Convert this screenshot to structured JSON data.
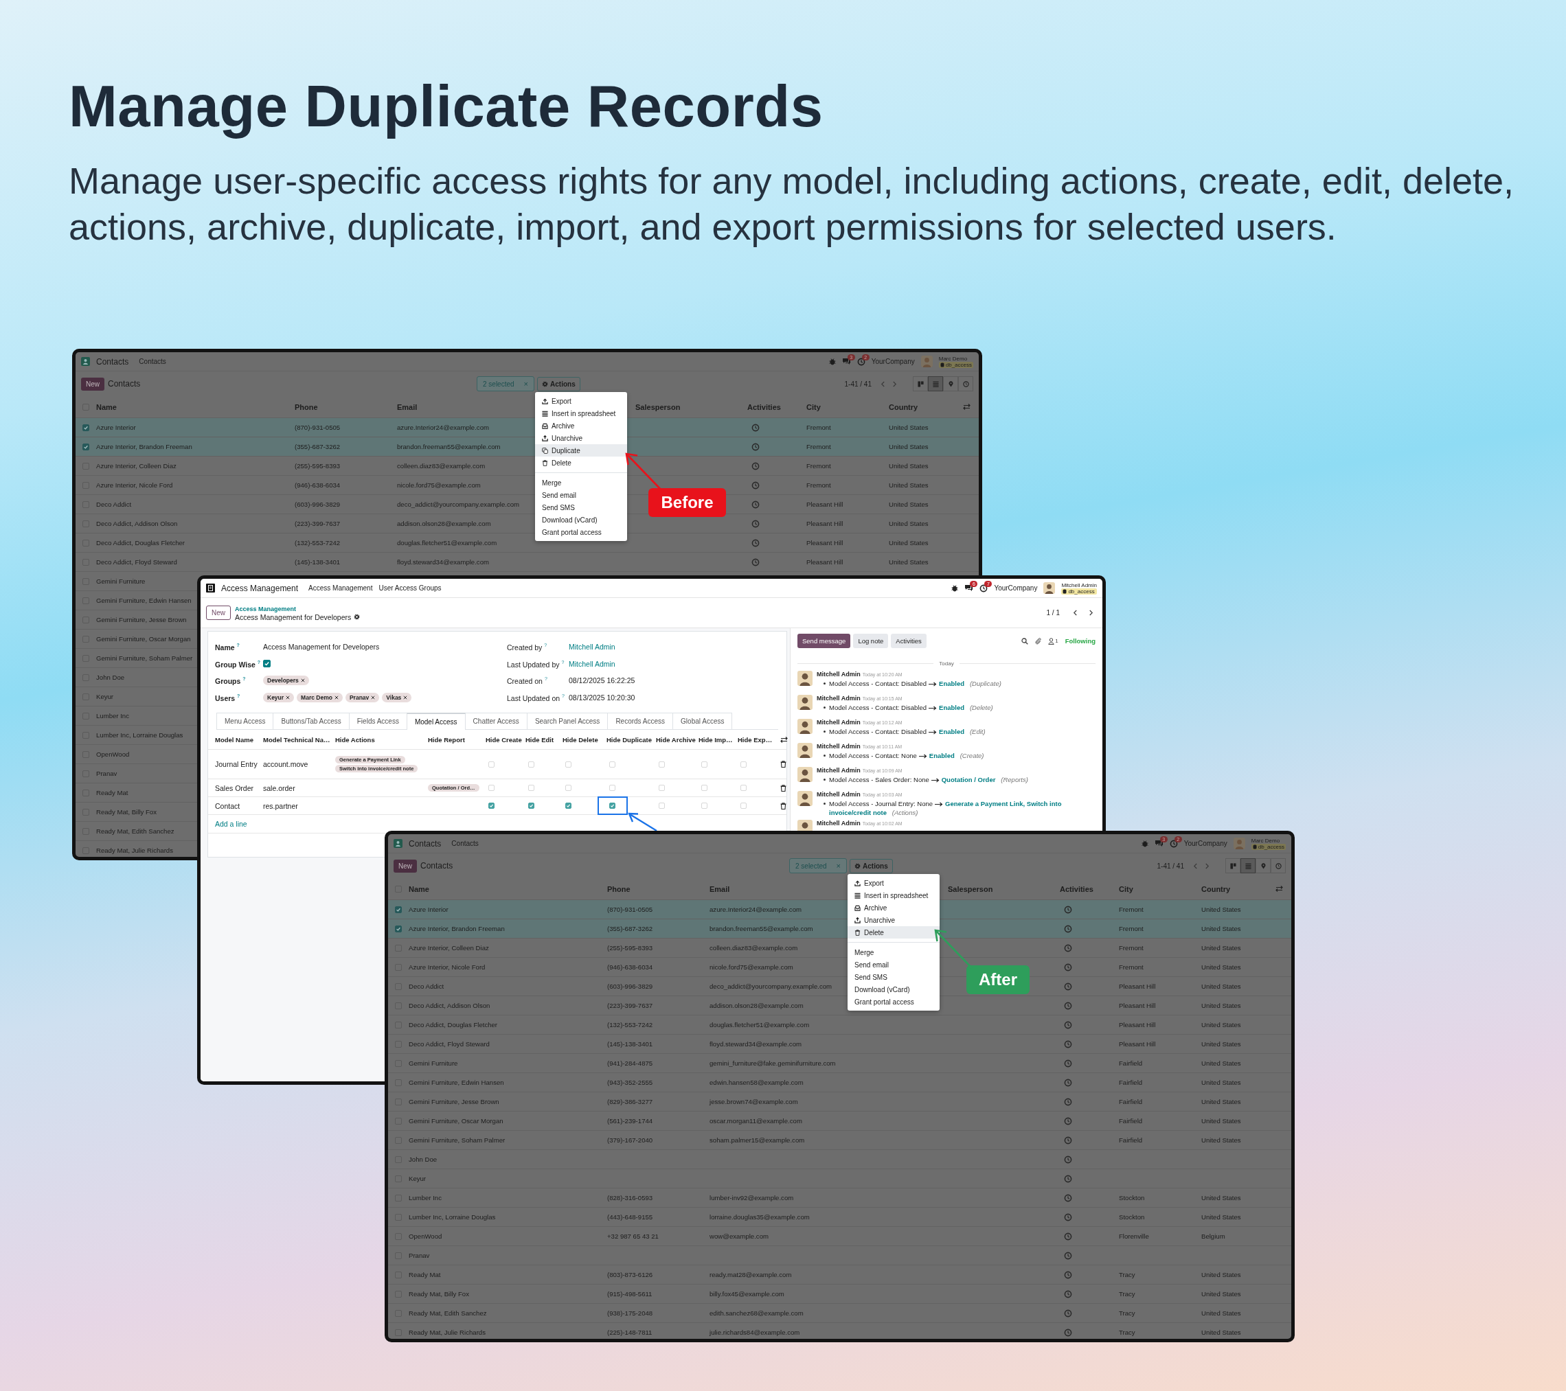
{
  "heading": "Manage Duplicate Records",
  "subheading": "Manage user-specific access rights for any model, including actions, create, edit, delete, actions, archive, duplicate, import, and export permissions for selected users.",
  "before_window": {
    "app_title": "Contacts",
    "menu": [
      "Contacts"
    ],
    "badges": [
      "3",
      "2"
    ],
    "company": "YourCompany",
    "user": "Marc Demo",
    "database": "db_access",
    "new_button": "New",
    "breadcrumb": "Contacts",
    "selection": "2 selected",
    "clear": "×",
    "actions_button": "Actions",
    "pager": "1-41 / 41",
    "views": [
      {
        "kind": "kanban",
        "selected": false
      },
      {
        "kind": "list",
        "selected": true
      },
      {
        "kind": "map",
        "selected": false
      },
      {
        "kind": "activity",
        "selected": false
      }
    ],
    "select_all_checked": false,
    "columns": [
      "Name",
      "Phone",
      "Email",
      "Salesperson",
      "Activities",
      "City",
      "Country"
    ],
    "rows": [
      {
        "name": "Azure Interior",
        "phone": "(870)-931-0505",
        "email": "azure.Interior24@example.com",
        "city": "Fremont",
        "country": "United States",
        "selected": true
      },
      {
        "name": "Azure Interior, Brandon Freeman",
        "phone": "(355)-687-3262",
        "email": "brandon.freeman55@example.com",
        "city": "Fremont",
        "country": "United States",
        "selected": true
      },
      {
        "name": "Azure Interior, Colleen Diaz",
        "phone": "(255)-595-8393",
        "email": "colleen.diaz83@example.com",
        "city": "Fremont",
        "country": "United States",
        "selected": false
      },
      {
        "name": "Azure Interior, Nicole Ford",
        "phone": "(946)-638-6034",
        "email": "nicole.ford75@example.com",
        "city": "Fremont",
        "country": "United States",
        "selected": false
      },
      {
        "name": "Deco Addict",
        "phone": "(603)-996-3829",
        "email": "deco_addict@yourcompany.example.com",
        "city": "Pleasant Hill",
        "country": "United States",
        "selected": false
      },
      {
        "name": "Deco Addict, Addison Olson",
        "phone": "(223)-399-7637",
        "email": "addison.olson28@example.com",
        "city": "Pleasant Hill",
        "country": "United States",
        "selected": false
      },
      {
        "name": "Deco Addict, Douglas Fletcher",
        "phone": "(132)-553-7242",
        "email": "douglas.fletcher51@example.com",
        "city": "Pleasant Hill",
        "country": "United States",
        "selected": false
      },
      {
        "name": "Deco Addict, Floyd Steward",
        "phone": "(145)-138-3401",
        "email": "floyd.steward34@example.com",
        "city": "Pleasant Hill",
        "country": "United States",
        "selected": false
      },
      {
        "name": "Gemini Furniture",
        "selected": false
      },
      {
        "name": "Gemini Furniture, Edwin Hansen",
        "selected": false
      },
      {
        "name": "Gemini Furniture, Jesse Brown",
        "selected": false
      },
      {
        "name": "Gemini Furniture, Oscar Morgan",
        "selected": false
      },
      {
        "name": "Gemini Furniture, Soham Palmer",
        "selected": false
      },
      {
        "name": "John Doe",
        "selected": false
      },
      {
        "name": "Keyur",
        "selected": false
      },
      {
        "name": "Lumber Inc",
        "selected": false
      },
      {
        "name": "Lumber Inc, Lorraine Douglas",
        "selected": false
      },
      {
        "name": "OpenWood",
        "selected": false
      },
      {
        "name": "Pranav",
        "selected": false
      },
      {
        "name": "Ready Mat",
        "selected": false
      },
      {
        "name": "Ready Mat, Billy Fox",
        "selected": false
      },
      {
        "name": "Ready Mat, Edith Sanchez",
        "selected": false
      },
      {
        "name": "Ready Mat, Julie Richards",
        "selected": false
      }
    ],
    "actions_menu": [
      [
        {
          "label": "Export",
          "kind": "export",
          "selected": false
        },
        {
          "label": "Insert in spreadsheet",
          "kind": "spreadsheet",
          "selected": false
        },
        {
          "label": "Archive",
          "kind": "archive",
          "selected": false
        },
        {
          "label": "Unarchive",
          "kind": "unarchive",
          "selected": false
        },
        {
          "label": "Duplicate",
          "kind": "duplicate",
          "selected": true
        },
        {
          "label": "Delete",
          "kind": "delete",
          "selected": false
        }
      ],
      [
        {
          "label": "Merge",
          "kind": "plain",
          "selected": false
        },
        {
          "label": "Send email",
          "kind": "plain",
          "selected": false
        },
        {
          "label": "Send SMS",
          "kind": "plain",
          "selected": false
        },
        {
          "label": "Download (vCard)",
          "kind": "plain",
          "selected": false
        },
        {
          "label": "Grant portal access",
          "kind": "plain",
          "selected": false
        }
      ]
    ],
    "callout": {
      "label": "Before",
      "color": "#e8121b"
    }
  },
  "access_window": {
    "app_title": "Access Management",
    "menu": [
      "Access Management",
      "User Access Groups"
    ],
    "badges": [
      "6",
      "7"
    ],
    "company": "YourCompany",
    "user": "Mitchell Admin",
    "database": "db_access",
    "new_button": "New",
    "breadcrumb_parent": "Access Management",
    "record_title": "Access Management for Developers",
    "pager": "1 / 1",
    "fields_left": [
      {
        "label": "Name $^{?}$",
        "kind": "text",
        "value": "Access Management for Developers"
      },
      {
        "label": "Group Wise $^{?}$",
        "kind": "checkbox",
        "checked": true
      },
      {
        "label": "Groups $^{?}$",
        "kind": "tags",
        "tags": [
          "Developers"
        ]
      },
      {
        "label": "Users $^{?}$",
        "kind": "tags",
        "tags": [
          "Keyur",
          "Marc Demo",
          "Pranav",
          "Vikas"
        ]
      }
    ],
    "fields_right": [
      {
        "label": "Created by $^{?}$",
        "kind": "link",
        "value": "Mitchell Admin"
      },
      {
        "label": "Last Updated by $^{?}$",
        "kind": "link",
        "value": "Mitchell Admin"
      },
      {
        "label": "Created on $^{?}$",
        "kind": "text",
        "value": "08/12/2025 16:22:25"
      },
      {
        "label": "Last Updated on $^{?}$",
        "kind": "text",
        "value": "08/13/2025 10:20:30"
      }
    ],
    "tabs": [
      {
        "label": "Menu Access",
        "selected": false
      },
      {
        "label": "Buttons/Tab Access",
        "selected": false
      },
      {
        "label": "Fields Access",
        "selected": false
      },
      {
        "label": "Model Access",
        "selected": true
      },
      {
        "label": "Chatter Access",
        "selected": false
      },
      {
        "label": "Search Panel Access",
        "selected": false
      },
      {
        "label": "Records Access",
        "selected": false
      },
      {
        "label": "Global Access",
        "selected": false
      }
    ],
    "table": {
      "columns": [
        "Model Name",
        "Model Technical Na…",
        "Hide Actions",
        "Hide Report",
        "Hide Create",
        "Hide Edit",
        "Hide Delete",
        "Hide Duplicate",
        "Hide Archive",
        "Hide Imp…",
        "Hide Exp…"
      ],
      "rows": [
        {
          "model": "Journal Entry",
          "technical": "account.move",
          "actions": [
            "Generate a Payment Link",
            "Switch into invoice/credit note"
          ],
          "reports": [],
          "checks": [
            false,
            false,
            false,
            false,
            false,
            false,
            false
          ]
        },
        {
          "model": "Sales Order",
          "technical": "sale.order",
          "actions": [],
          "reports": [
            "Quotation / Ord…"
          ],
          "checks": [
            false,
            false,
            false,
            false,
            false,
            false,
            false
          ]
        },
        {
          "model": "Contact",
          "technical": "res.partner",
          "actions": [],
          "reports": [],
          "checks": [
            true,
            true,
            true,
            true,
            false,
            false,
            false
          ]
        }
      ],
      "add_line": "Add a line"
    },
    "chatter": {
      "buttons": [
        {
          "label": "Send message",
          "kind": "primary"
        },
        {
          "label": "Log note",
          "kind": "secondary"
        },
        {
          "label": "Activities",
          "kind": "secondary"
        }
      ],
      "followers": "1",
      "following": "Following",
      "day": "Today",
      "messages": [
        {
          "author": "Mitchell Admin",
          "time": "Today at 10:20 AM",
          "change": "Model Access - Contact: Disabled",
          "value": "Enabled",
          "note": "(Duplicate)"
        },
        {
          "author": "Mitchell Admin",
          "time": "Today at 10:15 AM",
          "change": "Model Access - Contact: Disabled",
          "value": "Enabled",
          "note": "(Delete)"
        },
        {
          "author": "Mitchell Admin",
          "time": "Today at 10:12 AM",
          "change": "Model Access - Contact: Disabled",
          "value": "Enabled",
          "note": "(Edit)"
        },
        {
          "author": "Mitchell Admin",
          "time": "Today at 10:11 AM",
          "change": "Model Access - Contact: None",
          "value": "Enabled",
          "note": "(Create)"
        },
        {
          "author": "Mitchell Admin",
          "time": "Today at 10:09 AM",
          "change": "Model Access - Sales Order: None",
          "value": "Quotation / Order",
          "note": "(Reports)"
        },
        {
          "author": "Mitchell Admin",
          "time": "Today at 10:03 AM",
          "change": "Model Access - Journal Entry: None",
          "value": "Generate a Payment Link, Switch into invoice/credit note",
          "note": "(Actions)"
        },
        {
          "author": "Mitchell Admin",
          "time": "Today at 10:02 AM"
        }
      ]
    }
  },
  "after_window": {
    "app_title": "Contacts",
    "menu": [
      "Contacts"
    ],
    "badges": [
      "3",
      "2"
    ],
    "company": "YourCompany",
    "user": "Marc Demo",
    "database": "db_access",
    "new_button": "New",
    "breadcrumb": "Contacts",
    "selection": "2 selected",
    "clear": "×",
    "actions_button": "Actions",
    "pager": "1-41 / 41",
    "views": [
      {
        "kind": "kanban",
        "selected": false
      },
      {
        "kind": "list",
        "selected": true
      },
      {
        "kind": "map",
        "selected": false
      },
      {
        "kind": "activity",
        "selected": false
      }
    ],
    "select_all_checked": false,
    "columns": [
      "Name",
      "Phone",
      "Email",
      "Salesperson",
      "Activities",
      "City",
      "Country"
    ],
    "rows": [
      {
        "name": "Azure Interior",
        "phone": "(870)-931-0505",
        "email": "azure.Interior24@example.com",
        "city": "Fremont",
        "country": "United States",
        "selected": true
      },
      {
        "name": "Azure Interior, Brandon Freeman",
        "phone": "(355)-687-3262",
        "email": "brandon.freeman55@example.com",
        "city": "Fremont",
        "country": "United States",
        "selected": true
      },
      {
        "name": "Azure Interior, Colleen Diaz",
        "phone": "(255)-595-8393",
        "email": "colleen.diaz83@example.com",
        "city": "Fremont",
        "country": "United States",
        "selected": false
      },
      {
        "name": "Azure Interior, Nicole Ford",
        "phone": "(946)-638-6034",
        "email": "nicole.ford75@example.com",
        "city": "Fremont",
        "country": "United States",
        "selected": false
      },
      {
        "name": "Deco Addict",
        "phone": "(603)-996-3829",
        "email": "deco_addict@yourcompany.example.com",
        "city": "Pleasant Hill",
        "country": "United States",
        "selected": false
      },
      {
        "name": "Deco Addict, Addison Olson",
        "phone": "(223)-399-7637",
        "email": "addison.olson28@example.com",
        "city": "Pleasant Hill",
        "country": "United States",
        "selected": false
      },
      {
        "name": "Deco Addict, Douglas Fletcher",
        "phone": "(132)-553-7242",
        "email": "douglas.fletcher51@example.com",
        "city": "Pleasant Hill",
        "country": "United States",
        "selected": false
      },
      {
        "name": "Deco Addict, Floyd Steward",
        "phone": "(145)-138-3401",
        "email": "floyd.steward34@example.com",
        "city": "Pleasant Hill",
        "country": "United States",
        "selected": false
      },
      {
        "name": "Gemini Furniture",
        "phone": "(941)-284-4875",
        "email": "gemini_furniture@fake.geminifurniture.com",
        "city": "Fairfield",
        "country": "United States",
        "selected": false
      },
      {
        "name": "Gemini Furniture, Edwin Hansen",
        "phone": "(943)-352-2555",
        "email": "edwin.hansen58@example.com",
        "city": "Fairfield",
        "country": "United States",
        "selected": false
      },
      {
        "name": "Gemini Furniture, Jesse Brown",
        "phone": "(829)-386-3277",
        "email": "jesse.brown74@example.com",
        "city": "Fairfield",
        "country": "United States",
        "selected": false
      },
      {
        "name": "Gemini Furniture, Oscar Morgan",
        "phone": "(561)-239-1744",
        "email": "oscar.morgan11@example.com",
        "city": "Fairfield",
        "country": "United States",
        "selected": false
      },
      {
        "name": "Gemini Furniture, Soham Palmer",
        "phone": "(379)-167-2040",
        "email": "soham.palmer15@example.com",
        "city": "Fairfield",
        "country": "United States",
        "selected": false
      },
      {
        "name": "John Doe",
        "selected": false
      },
      {
        "name": "Keyur",
        "selected": false
      },
      {
        "name": "Lumber Inc",
        "phone": "(828)-316-0593",
        "email": "lumber-inv92@example.com",
        "city": "Stockton",
        "country": "United States",
        "selected": false
      },
      {
        "name": "Lumber Inc, Lorraine Douglas",
        "phone": "(443)-648-9155",
        "email": "lorraine.douglas35@example.com",
        "city": "Stockton",
        "country": "United States",
        "selected": false
      },
      {
        "name": "OpenWood",
        "phone": "+32 987 65 43 21",
        "email": "wow@example.com",
        "city": "Florenville",
        "country": "Belgium",
        "selected": false
      },
      {
        "name": "Pranav",
        "selected": false
      },
      {
        "name": "Ready Mat",
        "phone": "(803)-873-6126",
        "email": "ready.mat28@example.com",
        "city": "Tracy",
        "country": "United States",
        "selected": false
      },
      {
        "name": "Ready Mat, Billy Fox",
        "phone": "(915)-498-5611",
        "email": "billy.fox45@example.com",
        "city": "Tracy",
        "country": "United States",
        "selected": false
      },
      {
        "name": "Ready Mat, Edith Sanchez",
        "phone": "(938)-175-2048",
        "email": "edith.sanchez68@example.com",
        "city": "Tracy",
        "country": "United States",
        "selected": false
      },
      {
        "name": "Ready Mat, Julie Richards",
        "phone": "(225)-148-7811",
        "email": "julie.richards84@example.com",
        "city": "Tracy",
        "country": "United States",
        "selected": false
      }
    ],
    "actions_menu": [
      [
        {
          "label": "Export",
          "kind": "export",
          "selected": false
        },
        {
          "label": "Insert in spreadsheet",
          "kind": "spreadsheet",
          "selected": false
        },
        {
          "label": "Archive",
          "kind": "archive",
          "selected": false
        },
        {
          "label": "Unarchive",
          "kind": "unarchive",
          "selected": false
        },
        {
          "label": "Delete",
          "kind": "delete",
          "selected": true
        }
      ],
      [
        {
          "label": "Merge",
          "kind": "plain",
          "selected": false
        },
        {
          "label": "Send email",
          "kind": "plain",
          "selected": false
        },
        {
          "label": "Send SMS",
          "kind": "plain",
          "selected": false
        },
        {
          "label": "Download (vCard)",
          "kind": "plain",
          "selected": false
        },
        {
          "label": "Grant portal access",
          "kind": "plain",
          "selected": false
        }
      ]
    ],
    "callout": {
      "label": "After",
      "color": "#2e9e5b"
    }
  }
}
